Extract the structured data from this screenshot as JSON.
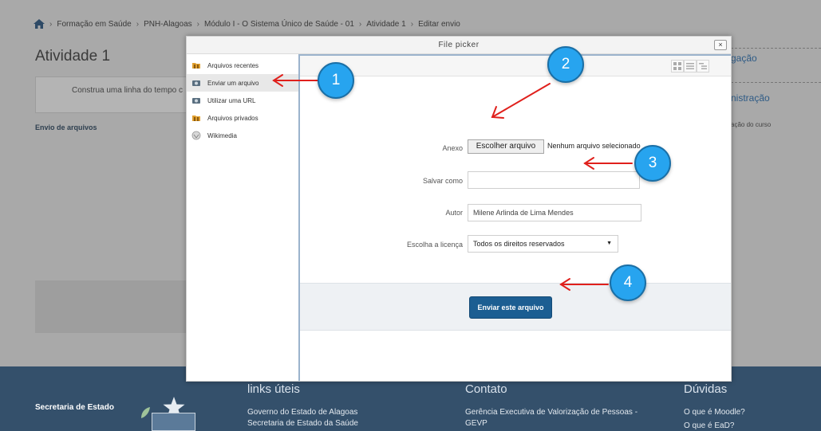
{
  "breadcrumb": [
    "Formação em Saúde",
    "PNH-Alagoas",
    "Módulo I - O Sistema Único de Saúde - 01",
    "Atividade 1",
    "Editar envio"
  ],
  "page": {
    "title": "Atividade 1",
    "activity_text": "Construa uma linha do tempo c",
    "envio_label": "Envio de arquivos",
    "right_nav": "gação",
    "right_admin": "nistração",
    "right_course": "ação do curso"
  },
  "modal": {
    "title": "File picker",
    "close": "×",
    "sidebar": [
      {
        "label": "Arquivos recentes",
        "icon": "recent-files-icon"
      },
      {
        "label": "Enviar um arquivo",
        "icon": "upload-icon"
      },
      {
        "label": "Utilizar uma URL",
        "icon": "url-icon"
      },
      {
        "label": "Arquivos privados",
        "icon": "private-files-icon"
      },
      {
        "label": "Wikimedia",
        "icon": "wikimedia-icon"
      }
    ],
    "form": {
      "anexo_label": "Anexo",
      "choose_button": "Escolher arquivo",
      "no_file": "Nenhum arquivo selecionado",
      "save_as_label": "Salvar como",
      "save_as_value": "",
      "author_label": "Autor",
      "author_value": "Milene Arlinda de Lima Mendes",
      "license_label": "Escolha a licença",
      "license_value": "Todos os direitos reservados",
      "upload_button": "Enviar este arquivo"
    }
  },
  "footer": {
    "links_title": "links úteis",
    "contact_title": "Contato",
    "doubts_title": "Dúvidas",
    "link1": "Governo do Estado de Alagoas",
    "link2": "Secretaria de Estado da Saúde",
    "contact1": "Gerência Executiva de Valorização de Pessoas -",
    "contact2": "GEVP",
    "doubt1": "O que é Moodle?",
    "doubt2": "O que é EaD?",
    "logo_text": "Secretaria de Estado"
  },
  "callouts": [
    "1",
    "2",
    "3",
    "4"
  ],
  "colors": {
    "callout": "#27a4ef",
    "arrow": "#e0201c",
    "upload_button": "#1c5e92",
    "footer": "#34506b"
  }
}
